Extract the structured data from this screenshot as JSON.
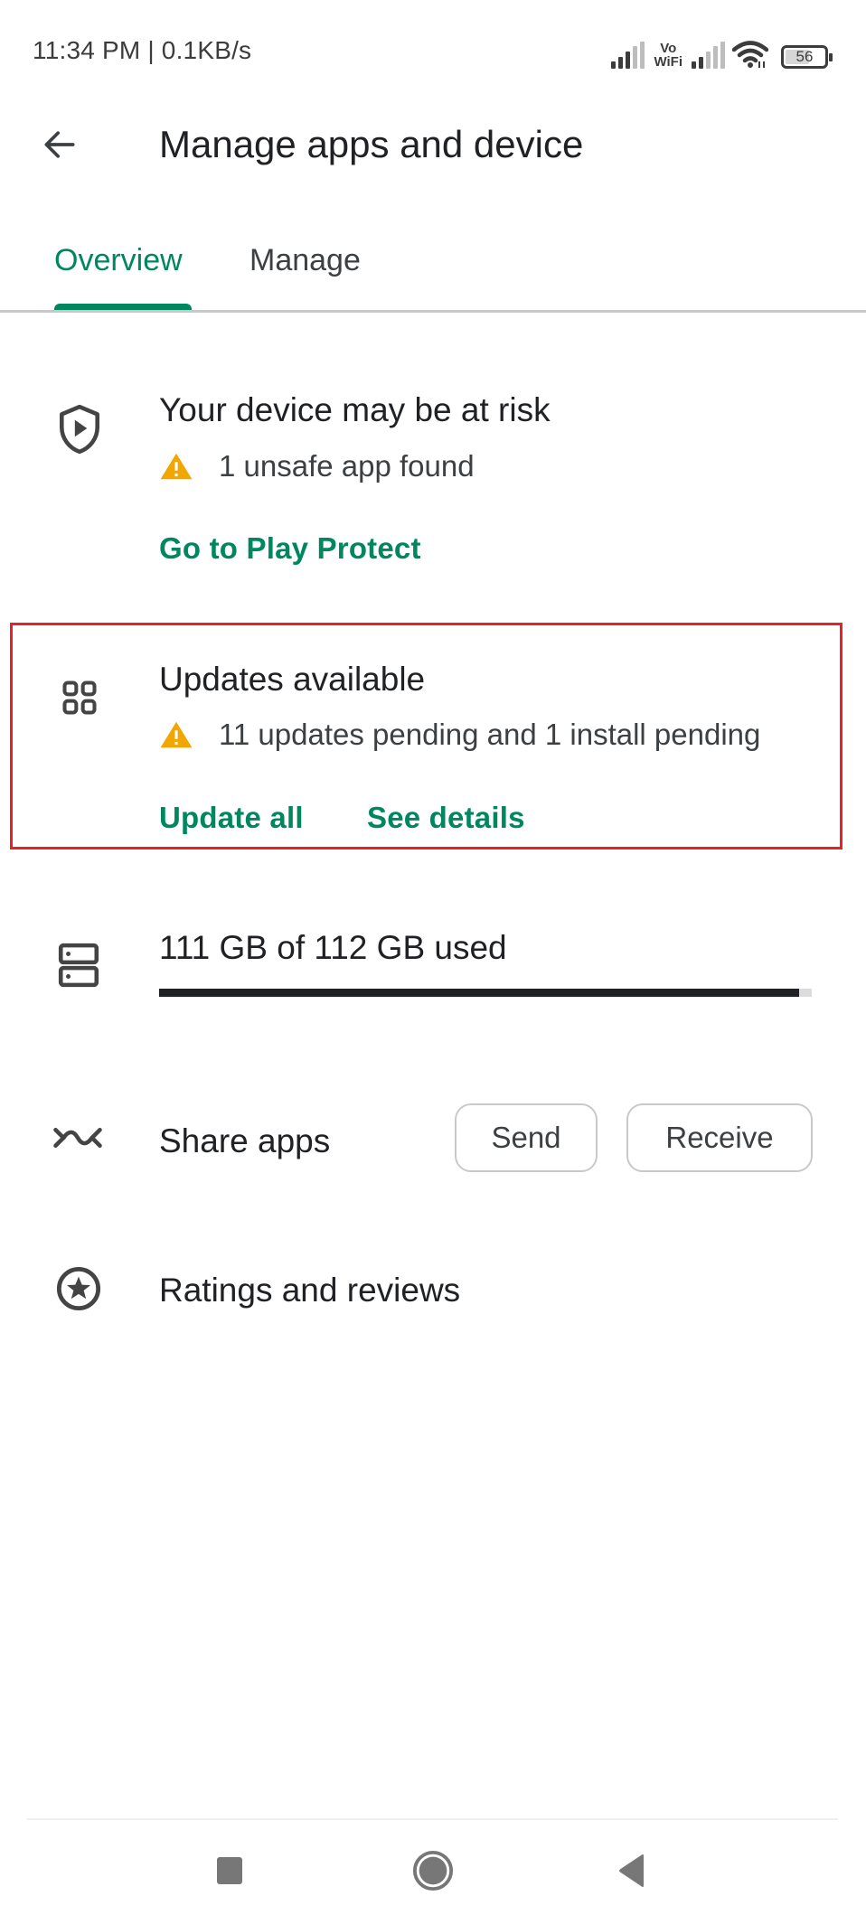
{
  "status_bar": {
    "time": "11:34 PM | 0.1KB/s",
    "vowifi_top": "Vo",
    "vowifi_bottom": "WiFi",
    "battery": "56",
    "icons": [
      "signal-icon",
      "vowifi-icon",
      "signal-icon",
      "wifi-icon",
      "battery-icon"
    ]
  },
  "header": {
    "back_icon": "arrow-left-icon",
    "title": "Manage apps and device"
  },
  "tabs": [
    {
      "label": "Overview",
      "selected": true
    },
    {
      "label": "Manage",
      "selected": false
    }
  ],
  "sections": {
    "protect": {
      "icon": "shield-play-icon",
      "title": "Your device may be at risk",
      "warning_icon": "warning-triangle-icon",
      "warning": "1 unsafe app found",
      "action": "Go to Play Protect"
    },
    "updates": {
      "icon": "apps-grid-icon",
      "title": "Updates available",
      "warning_icon": "warning-triangle-icon",
      "warning": "11 updates pending and 1 install pending",
      "actions": [
        "Update all",
        "See details"
      ],
      "highlighted": true
    },
    "storage": {
      "icon": "storage-icon",
      "label": "111 GB of 112 GB used",
      "used_gb": 111,
      "total_gb": 112,
      "used_fraction": 0.98
    },
    "share": {
      "icon": "share-apps-icon",
      "label": "Share apps",
      "buttons": [
        "Send",
        "Receive"
      ]
    },
    "ratings": {
      "icon": "star-circle-icon",
      "label": "Ratings and reviews"
    }
  },
  "nav_bar": {
    "buttons": [
      "recents-icon",
      "home-icon",
      "back-icon"
    ]
  },
  "colors": {
    "accent": "#01875f",
    "warning": "#f2a600",
    "highlight_border": "#e8202a",
    "text_primary": "#202124",
    "text_secondary": "#3c4043"
  }
}
